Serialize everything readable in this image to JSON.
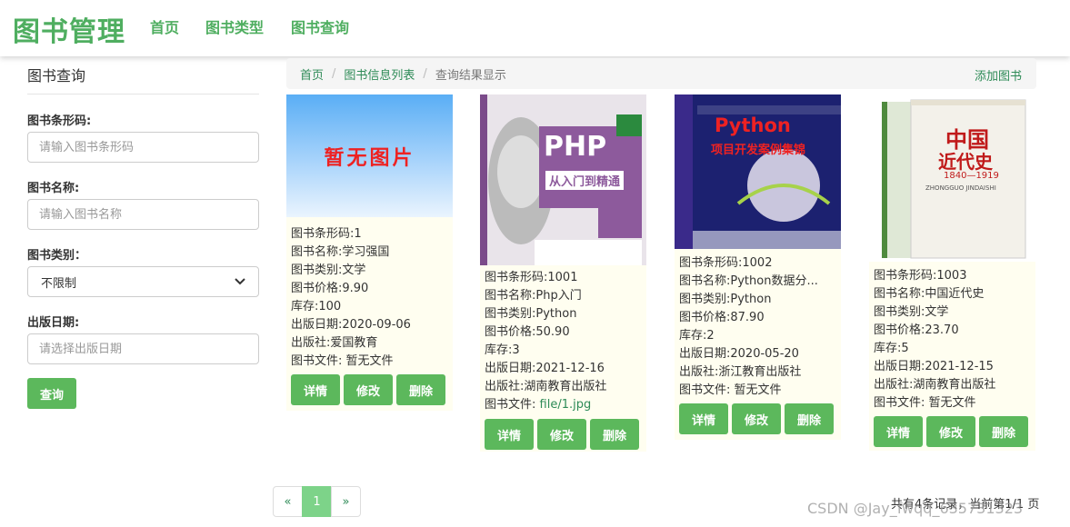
{
  "nav": {
    "brand": "图书管理",
    "links": [
      "首页",
      "图书类型",
      "图书查询"
    ]
  },
  "sidebar": {
    "title": "图书查询",
    "barcode_label": "图书条形码:",
    "barcode_placeholder": "请输入图书条形码",
    "name_label": "图书名称:",
    "name_placeholder": "请输入图书名称",
    "category_label": "图书类别：",
    "category_value": "不限制",
    "date_label": "出版日期:",
    "date_placeholder": "请选择出版日期",
    "search_button": "查询"
  },
  "breadcrumb": {
    "home": "首页",
    "list": "图书信息列表",
    "current": "查询结果显示",
    "add_link": "添加图书"
  },
  "books": [
    {
      "barcode": "图书条形码:1",
      "name": "图书名称:学习强国",
      "category": "图书类别:文学",
      "price": "图书价格:9.90",
      "stock": "库存:100",
      "date": "出版日期:2020-09-06",
      "publisher": "出版社:爱国教育",
      "file_label": "图书文件: ",
      "file_value": "暂无文件",
      "image_text": "暂无图片"
    },
    {
      "barcode": "图书条形码:1001",
      "name": "图书名称:Php入门",
      "category": "图书类别:Python",
      "price": "图书价格:50.90",
      "stock": "库存:3",
      "date": "出版日期:2021-12-16",
      "publisher": "出版社:湖南教育出版社",
      "file_label": "图书文件: ",
      "file_value": "file/1.jpg",
      "cover_title": "PHP",
      "cover_sub": "从入门到精通"
    },
    {
      "barcode": "图书条形码:1002",
      "name": "图书名称:Python数据分...",
      "category": "图书类别:Python",
      "price": "图书价格:87.90",
      "stock": "库存:2",
      "date": "出版日期:2020-05-20",
      "publisher": "出版社:浙江教育出版社",
      "file_label": "图书文件: ",
      "file_value": "暂无文件",
      "cover_title": "Python",
      "cover_sub": "项目开发案例集锦"
    },
    {
      "barcode": "图书条形码:1003",
      "name": "图书名称:中国近代史",
      "category": "图书类别:文学",
      "price": "图书价格:23.70",
      "stock": "库存:5",
      "date": "出版日期:2021-12-15",
      "publisher": "出版社:湖南教育出版社",
      "file_label": "图书文件: ",
      "file_value": "暂无文件",
      "cover_title": "中国",
      "cover_sub": "近代史",
      "cover_years": "1840—1919",
      "cover_pinyin": "ZHONGGUO JINDAISHI"
    }
  ],
  "card_buttons": {
    "detail": "详情",
    "edit": "修改",
    "delete": "删除"
  },
  "pagination": {
    "prev": "«",
    "current": "1",
    "next": "»",
    "summary": "共有4条记录，当前第1/1 页"
  },
  "watermark": "CSDN @Jay_fwqq_635731323"
}
